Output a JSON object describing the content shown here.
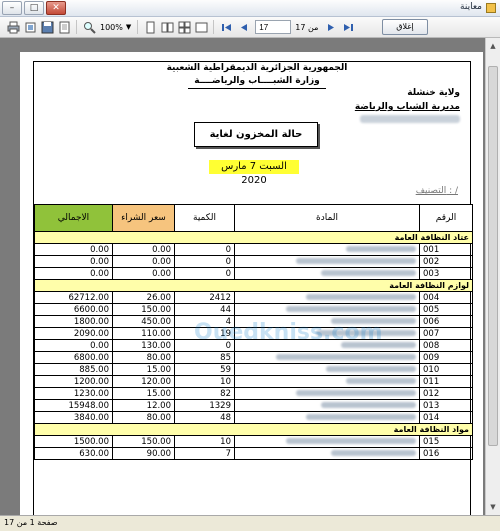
{
  "window": {
    "title": "معاينة"
  },
  "toolbar": {
    "zoom": "100%",
    "page_current": "17",
    "page_of": "من 17",
    "close_label": "إغلاق"
  },
  "report": {
    "header_right": [
      "الجمهورية الجزائرية الديمقراطية الشعبية",
      "وزارة الشبــــاب والرياضــــة"
    ],
    "header_left": [
      "ولاية خنشلة",
      "مديرية الشباب والرياضة"
    ],
    "title": "حالة المخزون لغاية",
    "date": "السبت 7 مارس 2020",
    "classification": "التصنيف : /",
    "columns": {
      "num": "الرقم",
      "material": "المادة",
      "qty": "الكمية",
      "price": "سعر الشراء",
      "total": "الاجمالي"
    },
    "groups": [
      {
        "label": "عتاد النظافة العامة",
        "rows": [
          {
            "code": "001",
            "qty": "0",
            "price": "0.00",
            "total": "0.00"
          },
          {
            "code": "002",
            "qty": "0",
            "price": "0.00",
            "total": "0.00"
          },
          {
            "code": "003",
            "qty": "0",
            "price": "0.00",
            "total": "0.00"
          }
        ]
      },
      {
        "label": "لوازم النظافة العامة",
        "rows": [
          {
            "code": "004",
            "qty": "2412",
            "price": "26.00",
            "total": "62712.00"
          },
          {
            "code": "005",
            "qty": "44",
            "price": "150.00",
            "total": "6600.00"
          },
          {
            "code": "006",
            "qty": "4",
            "price": "450.00",
            "total": "1800.00"
          },
          {
            "code": "007",
            "qty": "19",
            "price": "110.00",
            "total": "2090.00"
          },
          {
            "code": "008",
            "qty": "0",
            "price": "130.00",
            "total": "0.00"
          },
          {
            "code": "009",
            "qty": "85",
            "price": "80.00",
            "total": "6800.00"
          },
          {
            "code": "010",
            "qty": "59",
            "price": "15.00",
            "total": "885.00"
          },
          {
            "code": "011",
            "qty": "10",
            "price": "120.00",
            "total": "1200.00"
          },
          {
            "code": "012",
            "qty": "82",
            "price": "15.00",
            "total": "1230.00"
          },
          {
            "code": "013",
            "qty": "1329",
            "price": "12.00",
            "total": "15948.00"
          },
          {
            "code": "014",
            "qty": "48",
            "price": "80.00",
            "total": "3840.00"
          }
        ]
      },
      {
        "label": "مواد النظافة العامة",
        "rows": [
          {
            "code": "015",
            "qty": "10",
            "price": "150.00",
            "total": "1500.00"
          },
          {
            "code": "016",
            "qty": "7",
            "price": "90.00",
            "total": "630.00"
          }
        ]
      }
    ]
  },
  "watermark": "Ouedkniss.com",
  "status": {
    "page": "صفحة 1 من 17"
  }
}
